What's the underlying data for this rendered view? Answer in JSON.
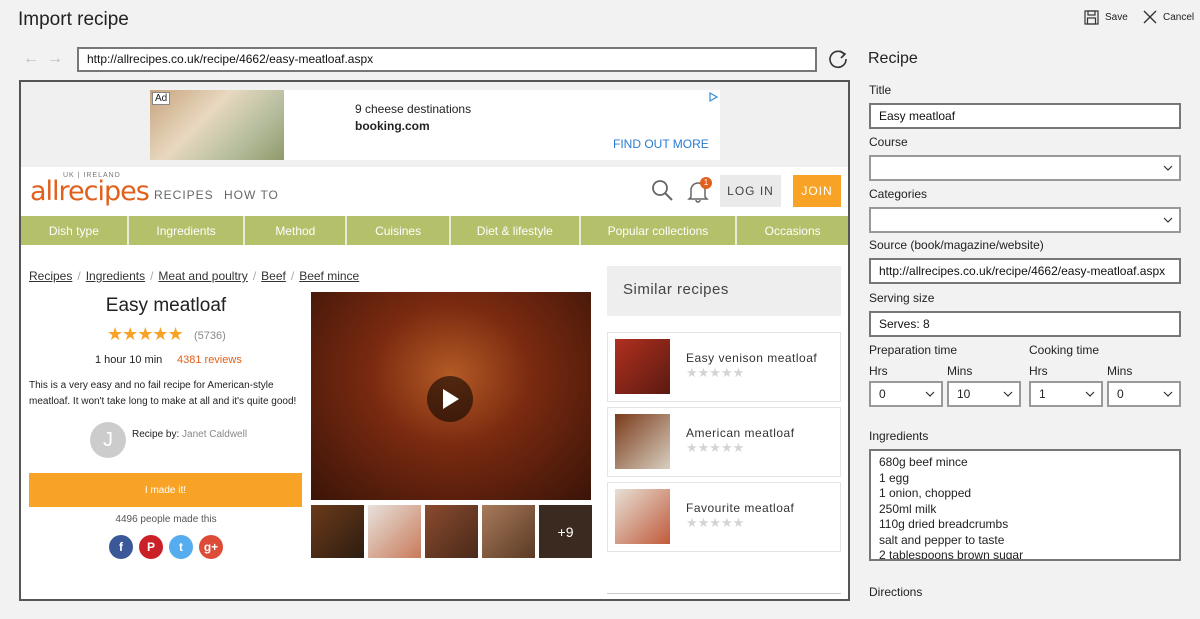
{
  "app": {
    "title": "Import recipe",
    "save_label": "Save",
    "cancel_label": "Cancel"
  },
  "browser": {
    "url": "http://allrecipes.co.uk/recipe/4662/easy-meatloaf.aspx"
  },
  "ad": {
    "tag": "Ad",
    "line1": "9 cheese destinations",
    "line2": "booking.com",
    "cta": "FIND OUT MORE"
  },
  "site": {
    "logo_region": "UK | IRELAND",
    "logo": "allrecipes",
    "nav": [
      "RECIPES",
      "HOW TO"
    ],
    "notifications": "1",
    "login": "LOG IN",
    "join": "JOIN",
    "categories": [
      "Dish type",
      "Ingredients",
      "Method",
      "Cuisines",
      "Diet & lifestyle",
      "Popular collections",
      "Occasions"
    ]
  },
  "recipe": {
    "breadcrumbs": [
      "Recipes",
      "Ingredients",
      "Meat and poultry",
      "Beef",
      "Beef mince"
    ],
    "title": "Easy meatloaf",
    "stars": "★★★★★",
    "rating_count": "(5736)",
    "time": "1 hour 10 min",
    "reviews": "4381 reviews",
    "description": "This is a very easy and no fail recipe for American-style meatloaf. It won't take long to make at all and it's quite good!",
    "avatar_letter": "J",
    "recipe_by_label": "Recipe by:",
    "author": "Janet Caldwell",
    "made_it": "I made it!",
    "made_count": "4496 people made this",
    "more_photos": "+9"
  },
  "similar": {
    "heading": "Similar recipes",
    "items": [
      {
        "title": "Easy venison meatloaf",
        "stars": "★★★★★"
      },
      {
        "title": "American meatloaf",
        "stars": "★★★★★"
      },
      {
        "title": "Favourite meatloaf",
        "stars": "★★★★★"
      }
    ]
  },
  "form": {
    "heading": "Recipe",
    "title_label": "Title",
    "title_value": "Easy meatloaf",
    "course_label": "Course",
    "course_value": "",
    "categories_label": "Categories",
    "categories_value": "",
    "source_label": "Source (book/magazine/website)",
    "source_value": "http://allrecipes.co.uk/recipe/4662/easy-meatloaf.aspx",
    "serving_label": "Serving size",
    "serving_value": "Serves: 8",
    "prep_label": "Preparation time",
    "cook_label": "Cooking time",
    "hrs_label": "Hrs",
    "mins_label": "Mins",
    "prep_hrs": "0",
    "prep_mins": "10",
    "cook_hrs": "1",
    "cook_mins": "0",
    "ingredients_label": "Ingredients",
    "ingredients": [
      "680g beef mince",
      "1 egg",
      "1 onion, chopped",
      "250ml milk",
      "110g dried breadcrumbs",
      "salt and pepper to taste",
      "2 tablespoons brown sugar"
    ],
    "directions_label": "Directions"
  },
  "colors": {
    "accent_orange": "#f9a326",
    "brand_orange": "#e0601c",
    "category_green": "#b4c06a"
  }
}
